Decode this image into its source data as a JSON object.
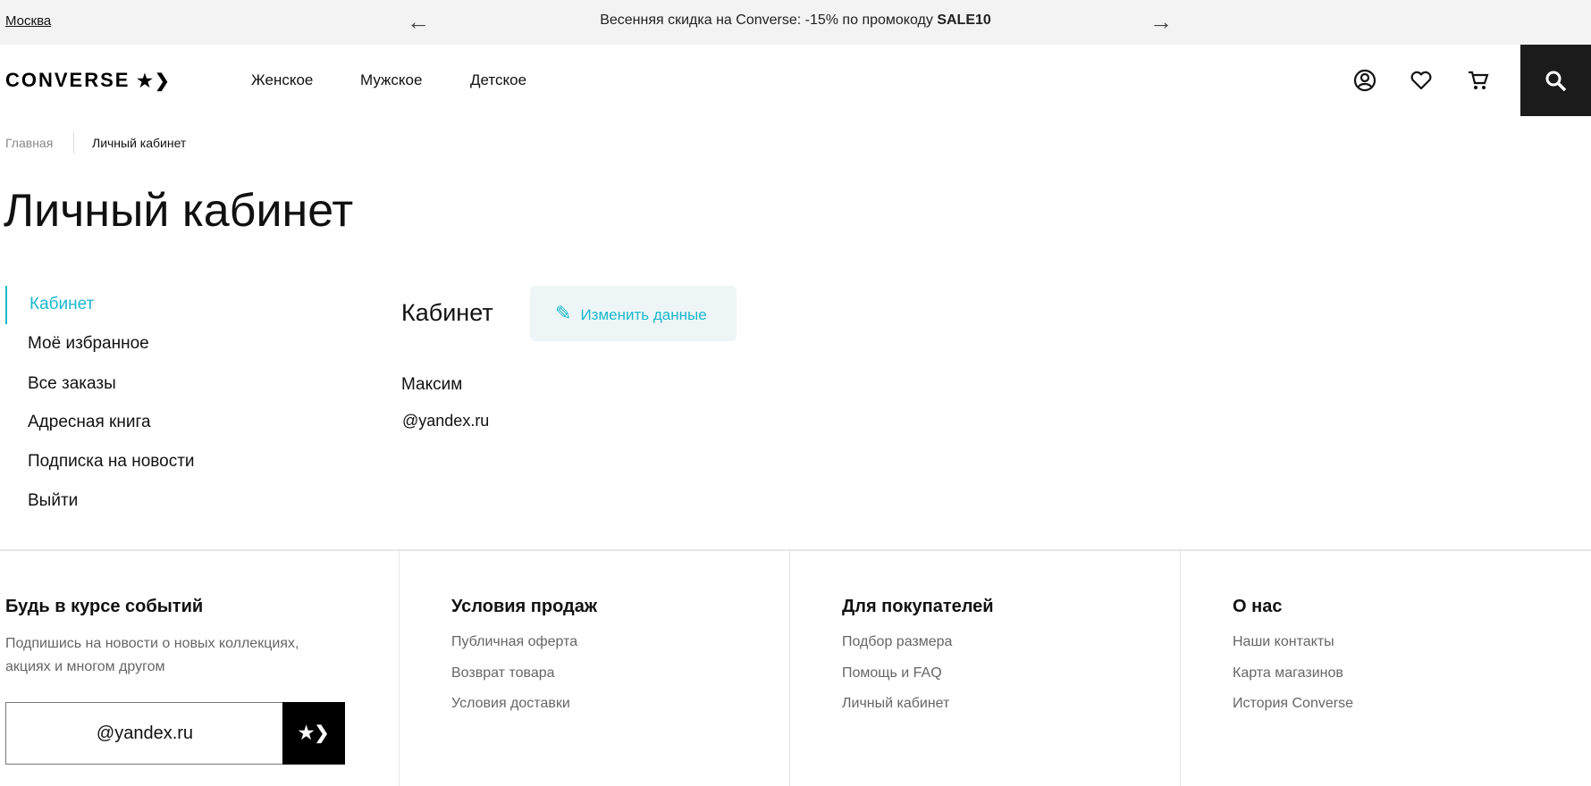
{
  "banner": {
    "city": "Москва",
    "promo_text": "Весенняя скидка на Converse: -15% по промокоду ",
    "promo_code": "SALE10"
  },
  "header": {
    "logo": "CONVERSE",
    "nav": [
      "Женское",
      "Мужское",
      "Детское"
    ],
    "icons": [
      "user-icon",
      "heart-icon",
      "cart-icon",
      "search-icon"
    ]
  },
  "breadcrumb": [
    "Главная",
    "Личный кабинет"
  ],
  "page_title": "Личный кабинет",
  "sidebar": {
    "items": [
      {
        "label": "Кабинет",
        "active": true
      },
      {
        "label": "Моё избранное"
      },
      {
        "label": "Все заказы"
      },
      {
        "label": "Адресная книга"
      },
      {
        "label": "Подписка на новости"
      },
      {
        "label": "Выйти"
      }
    ]
  },
  "main": {
    "title": "Кабинет",
    "edit_button": "Изменить данные",
    "name": "Максим",
    "email": "@yandex.ru"
  },
  "footer": {
    "newsletter": {
      "title": "Будь в курсе событий",
      "text1": "Подпишись на новости о новых коллекциях,",
      "text2": "акциях и многом другом",
      "email_value": "@yandex.ru"
    },
    "columns": [
      {
        "title": "Условия продаж",
        "links": [
          "Публичная оферта",
          "Возврат товара",
          "Условия доставки"
        ]
      },
      {
        "title": "Для покупателей",
        "links": [
          "Подбор размера",
          "Помощь и FAQ",
          "Личный кабинет"
        ]
      },
      {
        "title": "О нас",
        "links": [
          "Наши контакты",
          "Карта магазинов",
          "История Converse"
        ]
      }
    ]
  },
  "colors": {
    "accent": "#1bb8cc",
    "button_bg": "#edf5f7",
    "banner_bg": "#f3f3f3"
  }
}
